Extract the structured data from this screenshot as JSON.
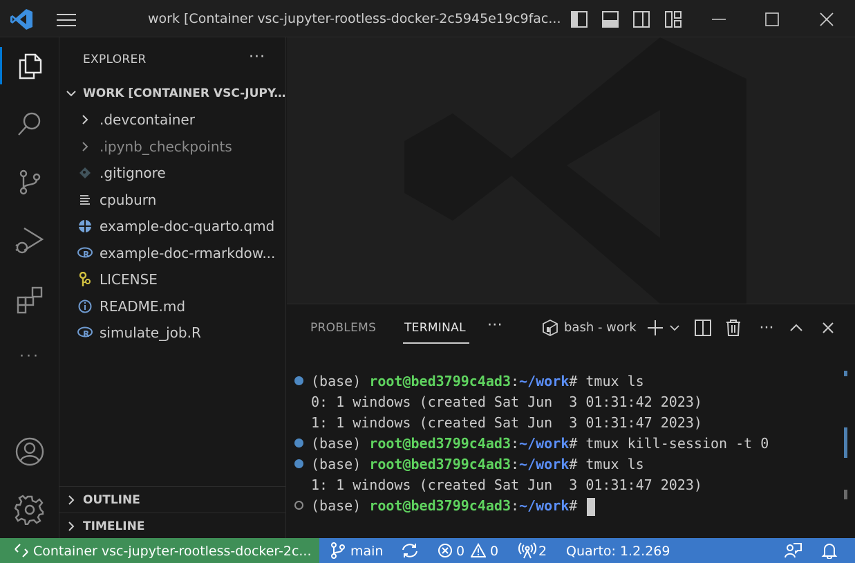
{
  "titlebar": {
    "title": "work [Container vsc-jupyter-rootless-docker-2c5945e19c9fac..."
  },
  "sidebar": {
    "header": "EXPLORER",
    "more": "···",
    "section_title": "WORK [CONTAINER VSC-JUPY...",
    "items": [
      {
        "name": ".devcontainer",
        "icon": "chevron-right-icon"
      },
      {
        "name": ".ipynb_checkpoints",
        "icon": "chevron-right-icon"
      },
      {
        "name": ".gitignore",
        "icon": "git-diamond-icon"
      },
      {
        "name": "cpuburn",
        "icon": "lines-file-icon"
      },
      {
        "name": "example-doc-quarto.qmd",
        "icon": "quarto-icon"
      },
      {
        "name": "example-doc-rmarkdow...",
        "icon": "r-icon"
      },
      {
        "name": "LICENSE",
        "icon": "key-icon"
      },
      {
        "name": "README.md",
        "icon": "info-icon"
      },
      {
        "name": "simulate_job.R",
        "icon": "r-icon"
      }
    ],
    "outline": "OUTLINE",
    "timeline": "TIMELINE"
  },
  "panel": {
    "tabs": [
      "PROBLEMS",
      "TERMINAL"
    ],
    "more": "···",
    "terminal_name": "bash - work",
    "lines": [
      {
        "dot": "filled",
        "prefix": "(base) ",
        "user": "root@bed3799c4ad3",
        "sep": ":",
        "path": "~/work",
        "prompt": "# ",
        "cmd": "tmux ls"
      },
      {
        "text": "0: 1 windows (created Sat Jun  3 01:31:42 2023)"
      },
      {
        "text": "1: 1 windows (created Sat Jun  3 01:31:47 2023)"
      },
      {
        "dot": "filled",
        "prefix": "(base) ",
        "user": "root@bed3799c4ad3",
        "sep": ":",
        "path": "~/work",
        "prompt": "# ",
        "cmd": "tmux kill-session -t 0"
      },
      {
        "dot": "filled",
        "prefix": "(base) ",
        "user": "root@bed3799c4ad3",
        "sep": ":",
        "path": "~/work",
        "prompt": "# ",
        "cmd": "tmux ls"
      },
      {
        "text": "1: 1 windows (created Sat Jun  3 01:31:47 2023)"
      },
      {
        "dot": "hollow",
        "prefix": "(base) ",
        "user": "root@bed3799c4ad3",
        "sep": ":",
        "path": "~/work",
        "prompt": "# ",
        "cmd": ""
      }
    ]
  },
  "statusbar": {
    "remote": "Container vsc-jupyter-rootless-docker-2c...",
    "branch": "main",
    "errors": "0",
    "warnings": "0",
    "ports": "2",
    "quarto": "Quarto: 1.2.269"
  },
  "colors": {
    "accent": "#0078d4",
    "statusbar": "#3a78c9",
    "remote": "#3f8f57",
    "prompt_user": "#5fd35f",
    "prompt_path": "#5b8ff9"
  }
}
